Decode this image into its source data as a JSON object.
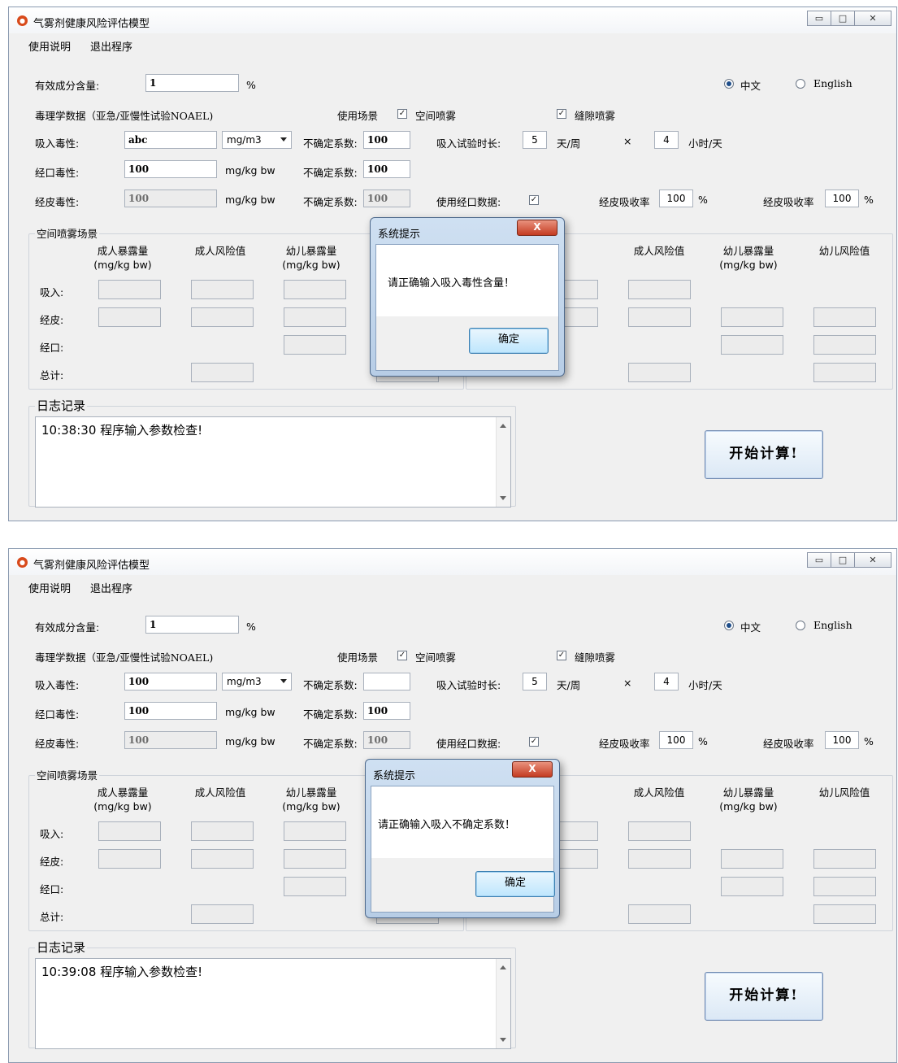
{
  "app": {
    "title": "气雾剂健康风险评估模型"
  },
  "window_buttons": {
    "minimize": "▭",
    "maximize": "□",
    "close": "✕"
  },
  "menu": {
    "help": "使用说明",
    "exit": "退出程序"
  },
  "form": {
    "active_label": "有效成分含量:",
    "percent": "%",
    "lang_cn": "中文",
    "lang_en": "English",
    "tox_header": "毒理学数据（亚急/亚慢性试验NOAEL)",
    "scene_label": "使用场景",
    "spray_space": "空间喷雾",
    "spray_crack": "缝隙喷雾",
    "inhal_label": "吸入毒性:",
    "oral_label": "经口毒性:",
    "dermal_label": "经皮毒性:",
    "unit_mgm3": "mg/m3",
    "unit_mgkg": "mg/kg bw",
    "uf_label": "不确定系数:",
    "duration_label": "吸入试验时长:",
    "days_unit": "天/周",
    "times": "×",
    "hours_unit": "小时/天",
    "use_oral_label": "使用经口数据:",
    "absorb_label": "经皮吸收率",
    "check": "✓"
  },
  "results": {
    "group_title": "空间喷雾场景",
    "col_adult_exp": "成人暴露量",
    "col_unit": "(mg/kg bw)",
    "col_adult_risk": "成人风险值",
    "col_child_exp": "幼儿暴露量",
    "col_child_risk": "幼儿风险值",
    "row_inhal": "吸入:",
    "row_dermal": "经皮:",
    "row_oral": "经口:",
    "row_total": "总计:"
  },
  "log": {
    "title": "日志记录"
  },
  "start_button": "开始计算!",
  "screens": [
    {
      "values": {
        "active": "1",
        "inhal": "abc",
        "inhal_uf": "100",
        "oral": "100",
        "oral_uf": "100",
        "dermal": "100",
        "dermal_uf": "100",
        "days": "5",
        "hours": "4",
        "absorb1": "100",
        "absorb2": "100"
      },
      "log_entry": "10:38:30 程序输入参数检查!",
      "dialog": {
        "title": "系统提示",
        "message": "请正确输入吸入毒性含量！",
        "ok": "确定",
        "close": "X"
      }
    },
    {
      "values": {
        "active": "1",
        "inhal": "100",
        "inhal_uf": "",
        "oral": "100",
        "oral_uf": "100",
        "dermal": "100",
        "dermal_uf": "100",
        "days": "5",
        "hours": "4",
        "absorb1": "100",
        "absorb2": "100"
      },
      "log_entry": "10:39:08 程序输入参数检查!",
      "dialog": {
        "title": "系统提示",
        "message": "请正确输入吸入不确定系数！",
        "ok": "确定",
        "close": "X"
      }
    }
  ]
}
